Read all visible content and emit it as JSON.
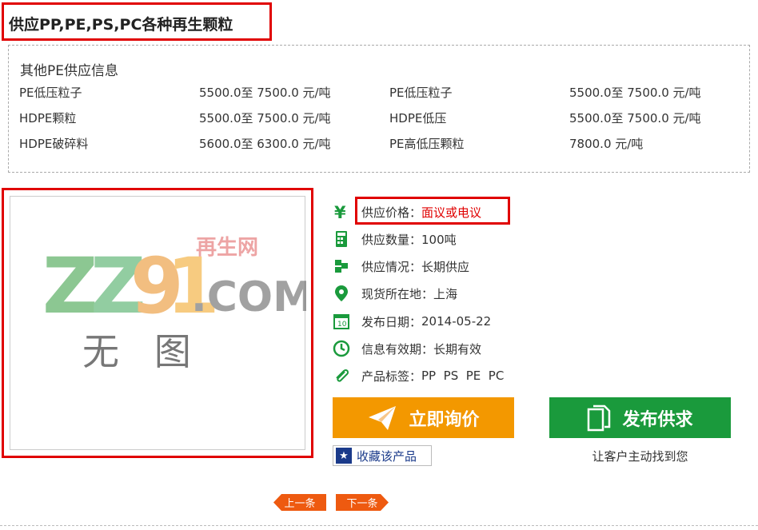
{
  "title": "供应PP,PE,PS,PC各种再生颗粒",
  "other_supply": {
    "heading": "其他PE供应信息",
    "rows": [
      {
        "name1": "PE低压粒子",
        "price1": "5500.0至 7500.0 元/吨",
        "name2": "PE低压粒子",
        "price2": "5500.0至 7500.0 元/吨"
      },
      {
        "name1": "HDPE颗粒",
        "price1": "5500.0至 7500.0 元/吨",
        "name2": "HDPE低压",
        "price2": "5500.0至 7500.0 元/吨"
      },
      {
        "name1": "HDPE破碎料",
        "price1": "5600.0至 6300.0 元/吨",
        "name2": "PE高低压颗粒",
        "price2": "7800.0 元/吨"
      }
    ]
  },
  "placeholder_image": {
    "logo_main": "ZZ91",
    "logo_suffix": ".COM",
    "logo_cn": "再生网",
    "no_image": "无   图"
  },
  "info": {
    "price_label": "供应价格：",
    "price_value": "面议或电议",
    "quantity_label": "供应数量：",
    "quantity_value": "100吨",
    "status_label": "供应情况：",
    "status_value": "长期供应",
    "location_label": "现货所在地：",
    "location_value": "上海",
    "date_label": "发布日期：",
    "date_value": "2014-05-22",
    "validity_label": "信息有效期：",
    "validity_value": "长期有效",
    "tags_label": "产品标签：",
    "tags_value": "PP  PS  PE  PC"
  },
  "actions": {
    "inquiry": "立即询价",
    "publish": "发布供求",
    "publish_sub": "让客户主动找到您",
    "favorite": "收藏该产品"
  },
  "pager": {
    "prev": "上一条",
    "next": "下一条"
  },
  "colors": {
    "highlight_red": "#e00000",
    "inquiry_orange": "#f39800",
    "publish_green": "#1a9a3c",
    "icon_green": "#1a9a3c",
    "pager_orange": "#ee5a10"
  }
}
